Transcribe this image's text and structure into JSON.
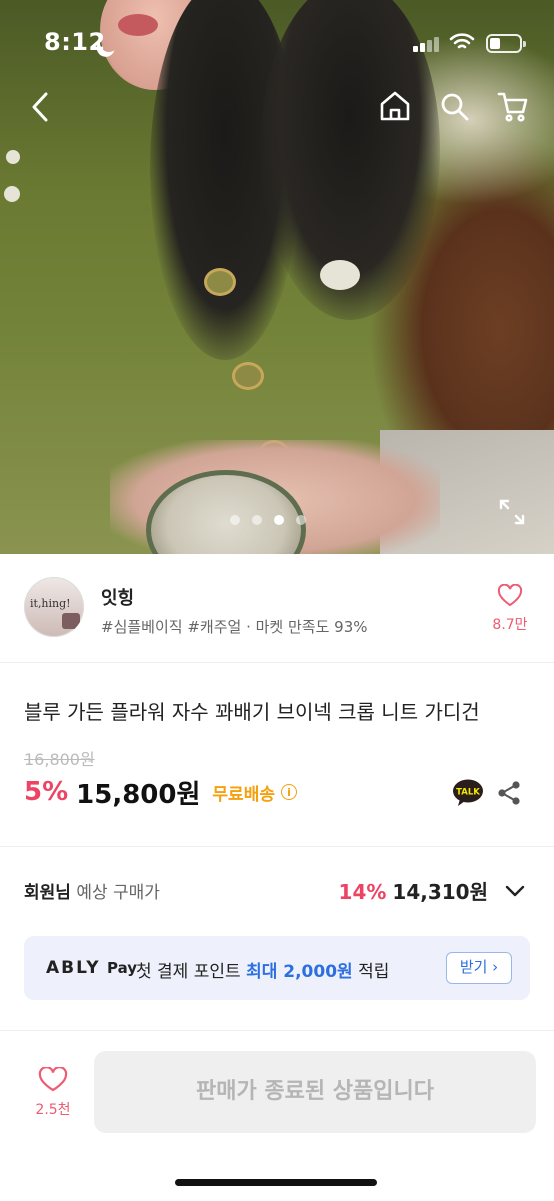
{
  "status_bar": {
    "time": "8:12"
  },
  "gallery": {
    "dot_count": 4,
    "active_dot": 2
  },
  "store": {
    "avatar_text": "it,hing!",
    "name": "잇힝",
    "meta": "#심플베이직 #캐주얼 · 마켓 만족도 93%",
    "like_count": "8.7만"
  },
  "product": {
    "title": "블루 가든 플라워 자수 꽈배기 브이넥 크롭 니트 가디건",
    "original_price": "16,800원",
    "discount": "5%",
    "price": "15,800원",
    "shipping": "무료배송",
    "talk_label": "TALK"
  },
  "member_price": {
    "label_bold": "회원님",
    "label_rest": " 예상 구매가",
    "discount": "14%",
    "price": "14,310원"
  },
  "ably_banner": {
    "logo": "ABLY",
    "pay": "Pay",
    "text_before": "첫 결제 포인트 ",
    "highlight": "최대 2,000원",
    "text_after": " 적립",
    "button": "받기 ›"
  },
  "bottom_bar": {
    "like_count": "2.5천",
    "sold_out_label": "판매가 종료된 상품입니다"
  },
  "colors": {
    "accent_pink": "#ee4464",
    "shipping_orange": "#f5a00c",
    "ably_blue": "#2b6fe0"
  }
}
